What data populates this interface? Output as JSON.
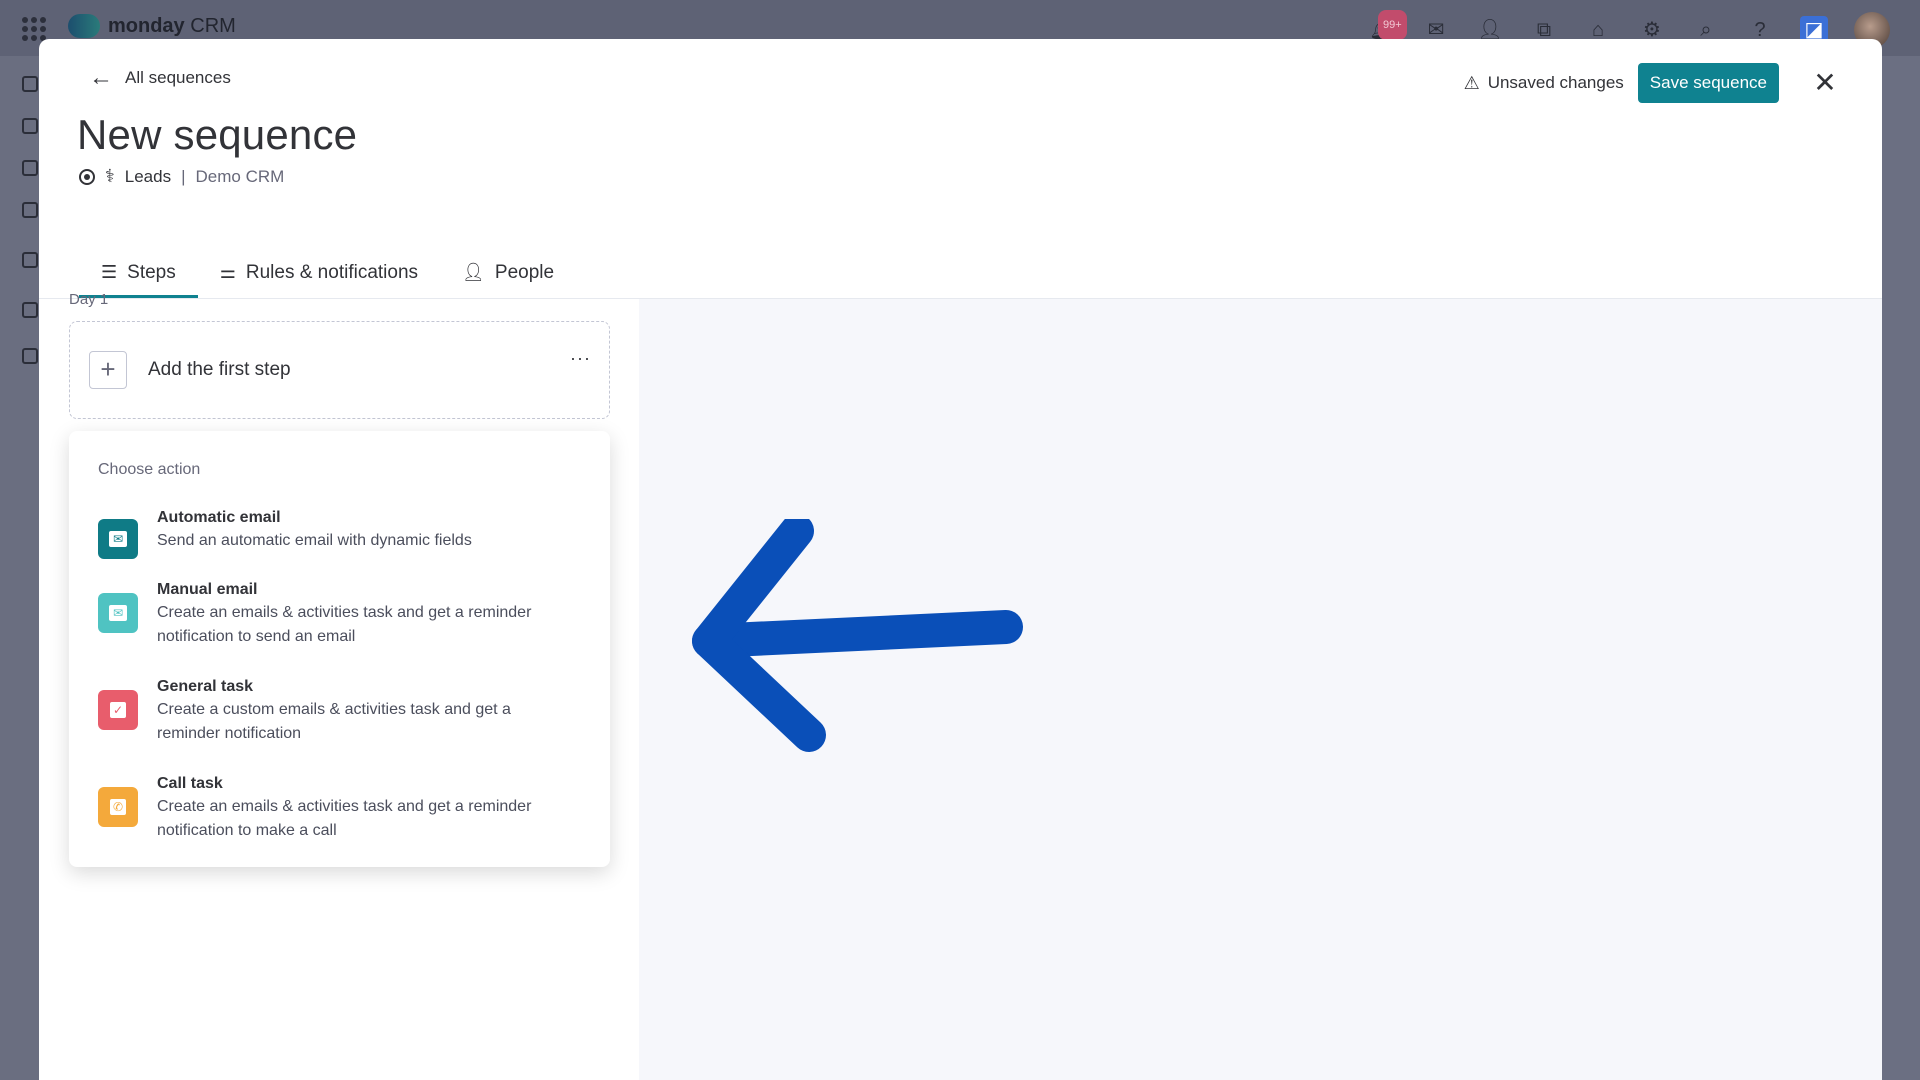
{
  "app": {
    "brand": "monday",
    "brand_suffix": "CRM",
    "notification_count": "99+"
  },
  "header": {
    "back_label": "All sequences",
    "title": "New sequence",
    "board_type": "Leads",
    "separator": "|",
    "board_name": "Demo CRM",
    "unsaved_label": "Unsaved changes",
    "save_label": "Save sequence"
  },
  "tabs": [
    {
      "label": "Steps",
      "icon": "steps-icon",
      "active": true
    },
    {
      "label": "Rules & notifications",
      "icon": "sliders-icon",
      "active": false
    },
    {
      "label": "People",
      "icon": "person-icon",
      "active": false
    }
  ],
  "steps": {
    "day_label": "Day 1",
    "first_step_label": "Add the first step",
    "more_label": "···"
  },
  "choose_action": {
    "title": "Choose action",
    "actions": [
      {
        "title": "Automatic email",
        "desc_lines": [
          "Send an automatic email with dynamic fields"
        ],
        "color": "#0f7b86"
      },
      {
        "title": "Manual email",
        "desc_lines": [
          "Create an emails & activities task and get a reminder",
          "notification to send an email"
        ],
        "color": "#4fc3c2"
      },
      {
        "title": "General task",
        "desc_lines": [
          "Create a custom emails & activities task and get a",
          "reminder notification"
        ],
        "color": "#e85d6c"
      },
      {
        "title": "Call task",
        "desc_lines": [
          "Create an emails & activities task and get a reminder",
          "notification to make a call"
        ],
        "color": "#f4a93b"
      }
    ]
  },
  "colors": {
    "accent": "#0f8290",
    "arrow": "#0a4fb8"
  }
}
